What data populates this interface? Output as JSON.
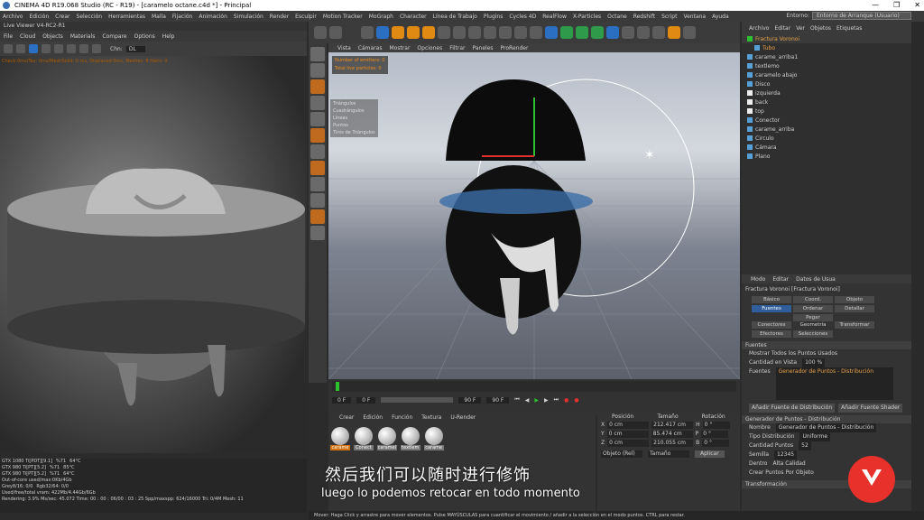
{
  "window": {
    "title": "CINEMA 4D R19.068 Studio (RC - R19) - [caramelo octane.c4d *] - Principal"
  },
  "menubar": [
    "Archivo",
    "Edición",
    "Crear",
    "Selección",
    "Herramientas",
    "Malla",
    "Fijación",
    "Animación",
    "Simulación",
    "Render",
    "Esculpir",
    "Motion Tracker",
    "MoGraph",
    "Character",
    "Línea de Trabajo",
    "Plugins",
    "Cycles 4D",
    "RealFlow",
    "X-Particles",
    "Octane",
    "Redshift",
    "Script",
    "Ventana",
    "Ayuda"
  ],
  "layout": {
    "label": "Entorno:",
    "value": "Entorno de Arranque (Usuario)"
  },
  "live_viewer": {
    "title": "Live Viewer V4-RC2-R1",
    "menu": [
      "File",
      "Cloud",
      "Objects",
      "Materials",
      "Compare",
      "Options",
      "Help"
    ],
    "hud": "Check:0ms/Tex: 0ms/MeshSolid: 0 ms, Displaced:0ms, Meshes: 8 Hairs: 0",
    "channel": "Chn:",
    "channel_value": "DL",
    "stats": [
      [
        "GTX 1080 Ti[PDT][9.1]",
        "%71",
        "64°C"
      ],
      [
        "GTX 980 Ti[PT][5.2]",
        "%71",
        "85°C"
      ],
      [
        "GTX 980 Ti[PT][5.2]",
        "%71",
        "64°C"
      ],
      [
        "Out-of-core used/max:0Kb/4Gb"
      ],
      [
        "Grey8/16: 0/0",
        "Rgb32/64: 0/0"
      ],
      [
        "Used/free/total vram: 422Mb/4.44Gb/6Gb"
      ]
    ],
    "rendering": "Rendering: 3.9%  Ms/sec: 45.072  Time: 00 : 00 : 06/00 : 03 : 25  Spp/maxspp: 624/16000  Tri: 0/4M  Mesh: 11"
  },
  "viewport": {
    "menu": [
      "Vista",
      "Cámaras",
      "Mostrar",
      "Opciones",
      "Filtrar",
      "Paneles",
      "ProRender"
    ],
    "emitters": "Number of emitters: 0",
    "particles": "Total live particles: 0",
    "info": [
      "Triángulos",
      "Cuadrángulos",
      "Líneas",
      "Puntos",
      "Tiros de Triángulos"
    ]
  },
  "timeline": {
    "start": "0 F",
    "end": "90 F",
    "current": "0 F",
    "max": "90 F"
  },
  "materials": {
    "tabs": [
      "Crear",
      "Edición",
      "Función",
      "Textura",
      "U-Render"
    ],
    "items": [
      "carame",
      "Conect",
      "caramel",
      "textlem",
      "carame"
    ]
  },
  "coords": {
    "headers": [
      "Posición",
      "Tamaño",
      "Rotación"
    ],
    "rows": [
      [
        "X",
        "0 cm",
        "212.417 cm",
        "H",
        "0 °"
      ],
      [
        "Y",
        "0 cm",
        "85.474 cm",
        "P",
        "0 °"
      ],
      [
        "Z",
        "0 cm",
        "210.055 cm",
        "B",
        "0 °"
      ]
    ],
    "mode": "Objeto (Rel)",
    "size": "Tamaño",
    "apply": "Aplicar"
  },
  "object_manager": {
    "menu": [
      "Archivo",
      "Editar",
      "Ver",
      "Objetos",
      "Etiquetas"
    ],
    "items": [
      "Fractura Voronoi",
      "Tubo",
      "carame_arriba1",
      "textlemo",
      "caramelo abajo",
      "Disco",
      "izquierda",
      "back",
      "top",
      "Conector",
      "carame_arriba",
      "Circulo",
      "Cámara",
      "Plano"
    ]
  },
  "attributes": {
    "menu": [
      "Modo",
      "Editar",
      "Datos de Usua"
    ],
    "object": "Fractura Voronoi [Fractura Voronoi]",
    "tabs": [
      "Básico",
      "Coord.",
      "Objeto",
      "Fuentes",
      "Ordenar",
      "Detallar",
      "Conectores",
      "Pegar Geometría",
      "Transformar",
      "Efectores",
      "Selecciones"
    ],
    "section_fuentes": "Fuentes",
    "show_all": "Mostrar Todos los Puntos Usados",
    "qty_label": "Cantidad en Vista",
    "qty_value": "100 %",
    "fuentes_label": "Fuentes",
    "fuentes_item": "Generador de Puntos - Distribución",
    "add_dist": "Añadir Fuente de Distribución",
    "add_shader": "Añadir Fuente Shader",
    "gen_header": "Generador de Puntos - Distribución",
    "name_label": "Nombre",
    "name_value": "Generador de Puntos - Distribución",
    "dist_label": "Tipo Distribución",
    "dist_value": "Uniforme",
    "count_label": "Cantidad Puntos",
    "count_value": "52",
    "seed_label": "Semilla",
    "seed_value": "12345",
    "inside_label": "Dentro",
    "hq_label": "Alta Calidad",
    "create_label": "Crear Puntos Por Objeto",
    "transform_label": "Transformación"
  },
  "statusbar": "Mover: Haga Click y arrastre para mover elementos. Pulse MAYÚSCULAS para cuantificar el movimiento / añadir a la selección en el modo puntos. CTRL para restar.",
  "subtitles": {
    "cn": "然后我们可以随时进行修饰",
    "es": "luego lo podemos retocar en todo momento"
  }
}
